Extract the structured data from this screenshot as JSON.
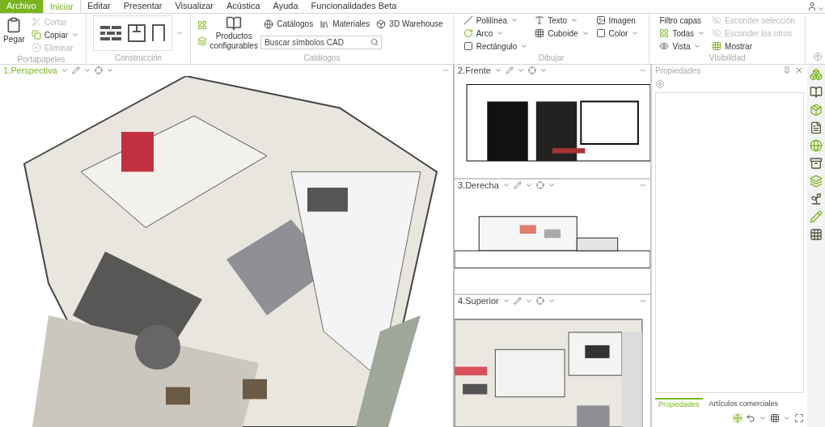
{
  "menu_tabs": [
    {
      "label": "Archivo",
      "kind": "file",
      "selected": false
    },
    {
      "label": "Iniciar",
      "kind": "tab",
      "selected": true
    },
    {
      "label": "Editar",
      "kind": "tab",
      "selected": false
    },
    {
      "label": "Presentar",
      "kind": "tab",
      "selected": false
    },
    {
      "label": "Visualizar",
      "kind": "tab",
      "selected": false
    },
    {
      "label": "Acústica",
      "kind": "tab",
      "selected": false
    },
    {
      "label": "Ayuda",
      "kind": "tab",
      "selected": false
    },
    {
      "label": "Funcionalidades Beta",
      "kind": "tab",
      "selected": false
    }
  ],
  "clipboard": {
    "label": "Portapapeles",
    "paste": {
      "label": "Pegar",
      "disabled": false
    },
    "items": [
      {
        "label": "Cortar",
        "disabled": true
      },
      {
        "label": "Copiar",
        "disabled": false
      },
      {
        "label": "Eliminar",
        "disabled": true
      }
    ]
  },
  "construction": {
    "label": "Construcción"
  },
  "catalogs": {
    "label": "Catálogos",
    "products": "Productos configurables",
    "links": [
      "Catálogos",
      "Materiales",
      "3D Warehouse"
    ],
    "search": {
      "placeholder": "Buscar símbolos CAD"
    }
  },
  "draw": {
    "label": "Dibujar",
    "items": [
      {
        "label": "Polilínea"
      },
      {
        "label": "Arco"
      },
      {
        "label": "Rectángulo"
      },
      {
        "label": "Texto"
      },
      {
        "label": "Cuboide"
      },
      {
        "label": "Imagen"
      },
      {
        "label": "Color"
      }
    ]
  },
  "visibility": {
    "label": "Visibilidad",
    "title": "Filtro capas",
    "items": [
      {
        "label": "Todas",
        "disabled": false
      },
      {
        "label": "Vista",
        "disabled": false
      },
      {
        "label": "Esconder selección",
        "disabled": true
      },
      {
        "label": "Esconder los otros",
        "disabled": true
      },
      {
        "label": "Mostrar",
        "disabled": false
      }
    ]
  },
  "viewports": [
    {
      "title": "1.Perspectiva",
      "selected": true
    },
    {
      "title": "2.Frente",
      "selected": false
    },
    {
      "title": "3.Derecha",
      "selected": false
    },
    {
      "title": "4.Superior",
      "selected": false
    }
  ],
  "properties": {
    "title": "Propiedades",
    "tabs": [
      {
        "label": "Propiedades",
        "selected": true
      },
      {
        "label": "Artículos comerciales",
        "selected": false
      }
    ]
  }
}
